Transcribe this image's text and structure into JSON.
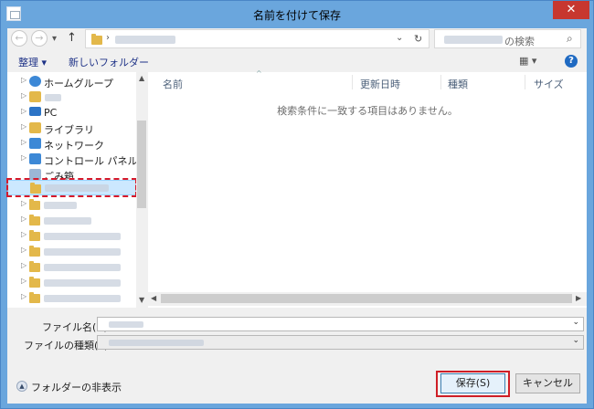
{
  "window": {
    "title": "名前を付けて保存",
    "close": "✕"
  },
  "nav": {
    "back": "←",
    "forward": "→",
    "recent": "▾",
    "up": "↑"
  },
  "address": {
    "breadcrumb_sep": "›",
    "dropdown": "⌄",
    "refresh": "↻"
  },
  "search": {
    "placeholder_suffix": "の検索",
    "icon": "⌕"
  },
  "toolbar": {
    "organize": "整理 ▾",
    "new_folder": "新しいフォルダー",
    "view": "▦ ▾",
    "help": "?"
  },
  "tree": [
    {
      "label": "ホームグループ",
      "icon": "homegroup-icon",
      "color": "#3c88d6"
    },
    {
      "label": "",
      "icon": "user-icon",
      "color": "#e3b84a"
    },
    {
      "label": "PC",
      "icon": "pc-icon",
      "color": "#2c74c6"
    },
    {
      "label": "ライブラリ",
      "icon": "library-icon",
      "color": "#e3b84a"
    },
    {
      "label": "ネットワーク",
      "icon": "network-icon",
      "color": "#3c88d6"
    },
    {
      "label": "コントロール パネル",
      "icon": "control-panel-icon",
      "color": "#3c88d6"
    },
    {
      "label": "ごみ箱",
      "icon": "recycle-bin-icon",
      "color": "#9bb7d6"
    }
  ],
  "columns": {
    "name": "名前",
    "modified": "更新日時",
    "type": "種類",
    "size": "サイズ",
    "sort_indicator": "^"
  },
  "empty_message": "検索条件に一致する項目はありません。",
  "form": {
    "filename_label": "ファイル名(N):",
    "filetype_label": "ファイルの種類(T):",
    "caret": "⌄"
  },
  "footer": {
    "hide_folders": "フォルダーの非表示",
    "save": "保存(S)",
    "cancel": "キャンセル"
  }
}
